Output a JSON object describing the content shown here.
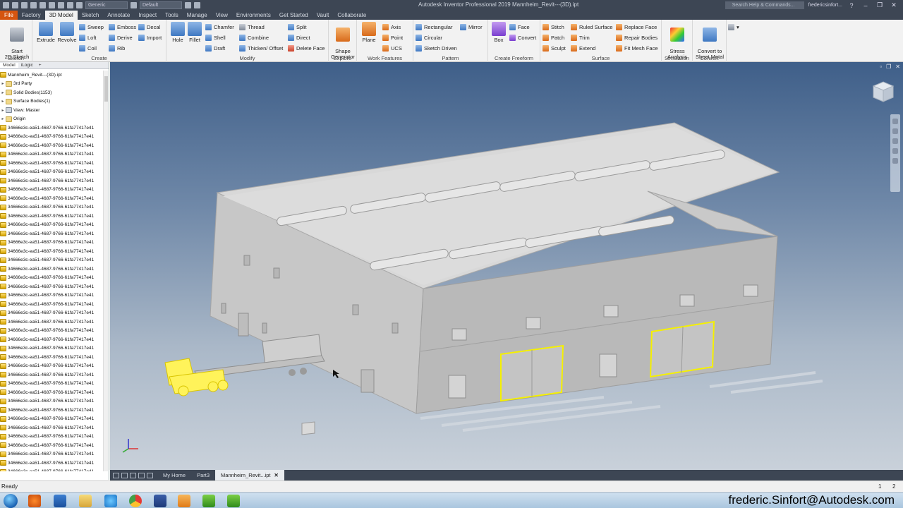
{
  "window": {
    "title": "Autodesk Inventor Professional 2019    Mannheim_Revit---(3D).ipt",
    "search_placeholder": "Search Help & Commands...",
    "user": "fredericsinfort...",
    "appearance_dropdown": "Generic",
    "material_dropdown": "Default"
  },
  "menu_tabs": [
    "File",
    "Factory",
    "3D Model",
    "Sketch",
    "Annotate",
    "Inspect",
    "Tools",
    "Manage",
    "View",
    "Environments",
    "Get Started",
    "Vault",
    "Collaborate"
  ],
  "ribbon": {
    "sketch": {
      "label": "Sketch",
      "start": "Start\n2D Sketch"
    },
    "create": {
      "label": "Create",
      "extrude": "Extrude",
      "revolve": "Revolve",
      "sweep": "Sweep",
      "emboss": "Emboss",
      "decal": "Decal",
      "loft": "Loft",
      "derive": "Derive",
      "import": "Import",
      "coil": "Coil",
      "rib": "Rib"
    },
    "modify": {
      "label": "Modify",
      "hole": "Hole",
      "fillet": "Fillet",
      "chamfer": "Chamfer",
      "thread": "Thread",
      "split": "Split",
      "shell": "Shell",
      "combine": "Combine",
      "direct": "Direct",
      "draft": "Draft",
      "thicken": "Thicken/ Offset",
      "delete_face": "Delete Face"
    },
    "explore": {
      "label": "Explore",
      "shape_generator": "Shape\nGenerator"
    },
    "work_features": {
      "label": "Work Features",
      "plane": "Plane",
      "axis": "Axis",
      "point": "Point",
      "ucs": "UCS"
    },
    "pattern": {
      "label": "Pattern",
      "rectangular": "Rectangular",
      "mirror": "Mirror",
      "circular": "Circular",
      "sketch_driven": "Sketch Driven"
    },
    "freeform": {
      "label": "Create Freeform",
      "box": "Box",
      "face": "Face",
      "convert": "Convert"
    },
    "surface": {
      "label": "Surface",
      "stitch": "Stitch",
      "ruled_surface": "Ruled Surface",
      "replace_face": "Replace Face",
      "patch": "Patch",
      "trim": "Trim",
      "repair_bodies": "Repair Bodies",
      "sculpt": "Sculpt",
      "extend": "Extend",
      "fit_mesh_face": "Fit Mesh Face"
    },
    "simulation": {
      "label": "Simulation",
      "stress": "Stress\nAnalysis"
    },
    "convert": {
      "label": "Convert",
      "sheet_metal": "Convert to\nSheet Metal"
    }
  },
  "browser": {
    "tabs": [
      "Model",
      "iLogic"
    ],
    "root": "Mannheim_Revit---(3D).ipt",
    "nodes": [
      "3rd Party",
      "Solid Bodies(1153)",
      "Surface Bodies(1)",
      "View: Master",
      "Origin"
    ],
    "part_item_label": "34666e3c-ea51-4687-9766-61fa77417e41",
    "part_item_count": 40
  },
  "document_tabs": [
    "My Home",
    "Part3",
    "Mannheim_Revit...ipt"
  ],
  "status": {
    "ready": "Ready",
    "page_a": "1",
    "page_b": "2"
  },
  "overlay_email": "frederic.Sinfort@Autodesk.com",
  "colors": {
    "file_tab": "#d5550f",
    "title_bar": "#3d4654",
    "highlight": "#f5f000"
  }
}
